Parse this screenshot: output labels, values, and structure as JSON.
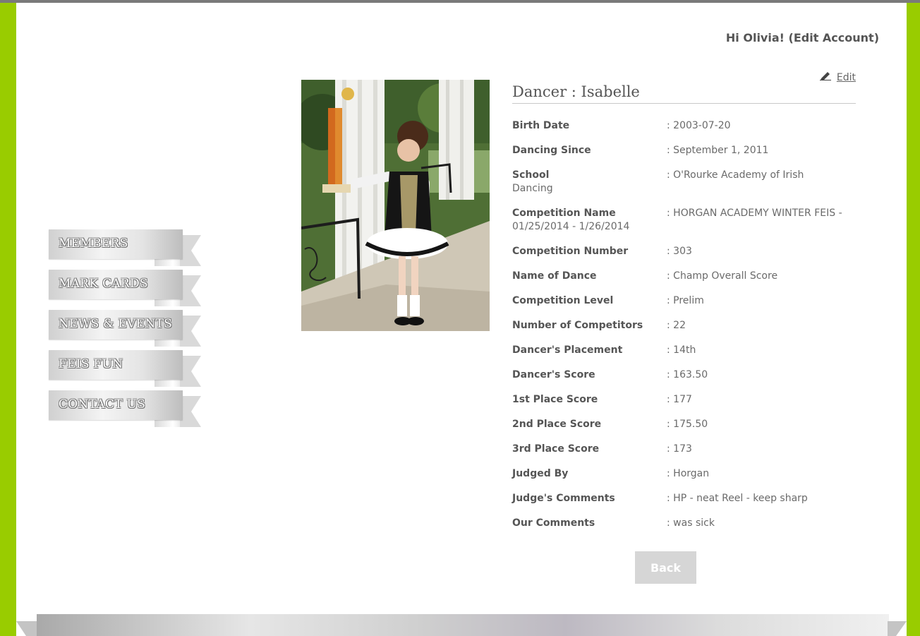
{
  "header": {
    "greeting": "Hi Olivia!",
    "edit_account": "(Edit Account)"
  },
  "sidebar": {
    "items": [
      {
        "label": "MEMBERS"
      },
      {
        "label": "MARK CARDS"
      },
      {
        "label": "NEWS & EVENTS"
      },
      {
        "label": "FEIS FUN"
      },
      {
        "label": "CONTACT US"
      }
    ]
  },
  "dancer": {
    "edit_label": "Edit",
    "title": "Dancer : Isabelle",
    "fields": [
      {
        "label": "Birth Date",
        "value": ": 2003-07-20"
      },
      {
        "label": "Dancing Since",
        "value": ": September 1, 2011"
      },
      {
        "label": "School",
        "extra": "Dancing",
        "value": ": O'Rourke Academy of Irish"
      },
      {
        "label": "Competition Name",
        "extra": "01/25/2014 - 1/26/2014",
        "value": ": HORGAN ACADEMY WINTER FEIS -"
      },
      {
        "label": "Competition Number",
        "value": ": 303"
      },
      {
        "label": "Name of Dance",
        "value": ": Champ Overall Score"
      },
      {
        "label": "Competition Level",
        "value": ": Prelim"
      },
      {
        "label": "Number of Competitors",
        "value": ": 22"
      },
      {
        "label": "Dancer's Placement",
        "value": ": 14th"
      },
      {
        "label": "Dancer's Score",
        "value": ": 163.50"
      },
      {
        "label": "1st Place Score",
        "value": ": 177"
      },
      {
        "label": "2nd Place Score",
        "value": ": 175.50"
      },
      {
        "label": "3rd Place Score",
        "value": ": 173"
      },
      {
        "label": "Judged By",
        "value": ": Horgan"
      },
      {
        "label": "Judge's Comments",
        "value": ": HP - neat Reel - keep sharp"
      },
      {
        "label": "Our Comments",
        "value": ": was sick"
      }
    ],
    "back_label": "Back"
  },
  "colors": {
    "frame_green": "#99cc00",
    "text_gray": "#555555",
    "button_gray": "#d6d6d6"
  }
}
